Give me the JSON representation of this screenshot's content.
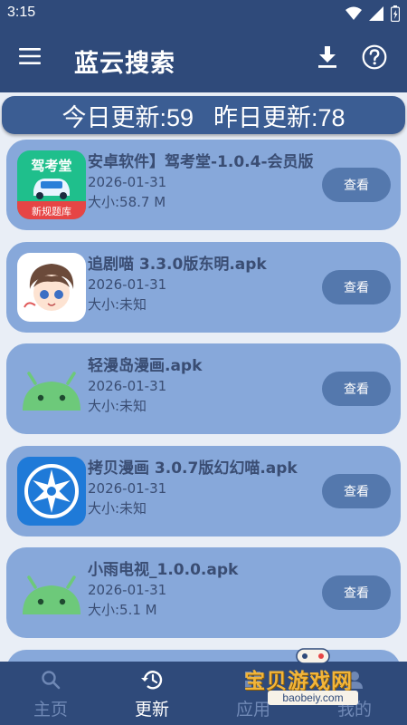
{
  "status_bar": {
    "time": "3:15"
  },
  "app_bar": {
    "title": "蓝云搜索"
  },
  "stats": {
    "today": "今日更新:59",
    "yesterday": "昨日更新:78"
  },
  "items": [
    {
      "title": "安卓软件】驾考堂-1.0.4-会员版",
      "date": "2026-01-31",
      "size": "大小:58.7 M",
      "button": "查看",
      "icon_text_top": "驾考堂",
      "icon_text_bottom": "新规题库"
    },
    {
      "title": "追剧喵 3.3.0版东明.apk",
      "date": "2026-01-31",
      "size": "大小:未知",
      "button": "查看"
    },
    {
      "title": "轻漫岛漫画.apk",
      "date": "2026-01-31",
      "size": "大小:未知",
      "button": "查看"
    },
    {
      "title": "拷贝漫画 3.0.7版幻幻喵.apk",
      "date": "2026-01-31",
      "size": "大小:未知",
      "button": "查看"
    },
    {
      "title": "小雨电视_1.0.0.apk",
      "date": "2026-01-31",
      "size": "大小:5.1 M",
      "button": "查看"
    }
  ],
  "bottom_nav": [
    {
      "label": "主页",
      "icon": "search-icon"
    },
    {
      "label": "更新",
      "icon": "history-icon"
    },
    {
      "label": "应用",
      "icon": "apps-icon"
    },
    {
      "label": "我的",
      "icon": "person-icon"
    }
  ],
  "watermark": {
    "text": "宝贝游戏网",
    "domain": "baobeiy.com"
  },
  "colors": {
    "primary": "#2f4a7a",
    "card": "#87a8da",
    "button": "#5478ad",
    "banner": "#3b5d93"
  }
}
